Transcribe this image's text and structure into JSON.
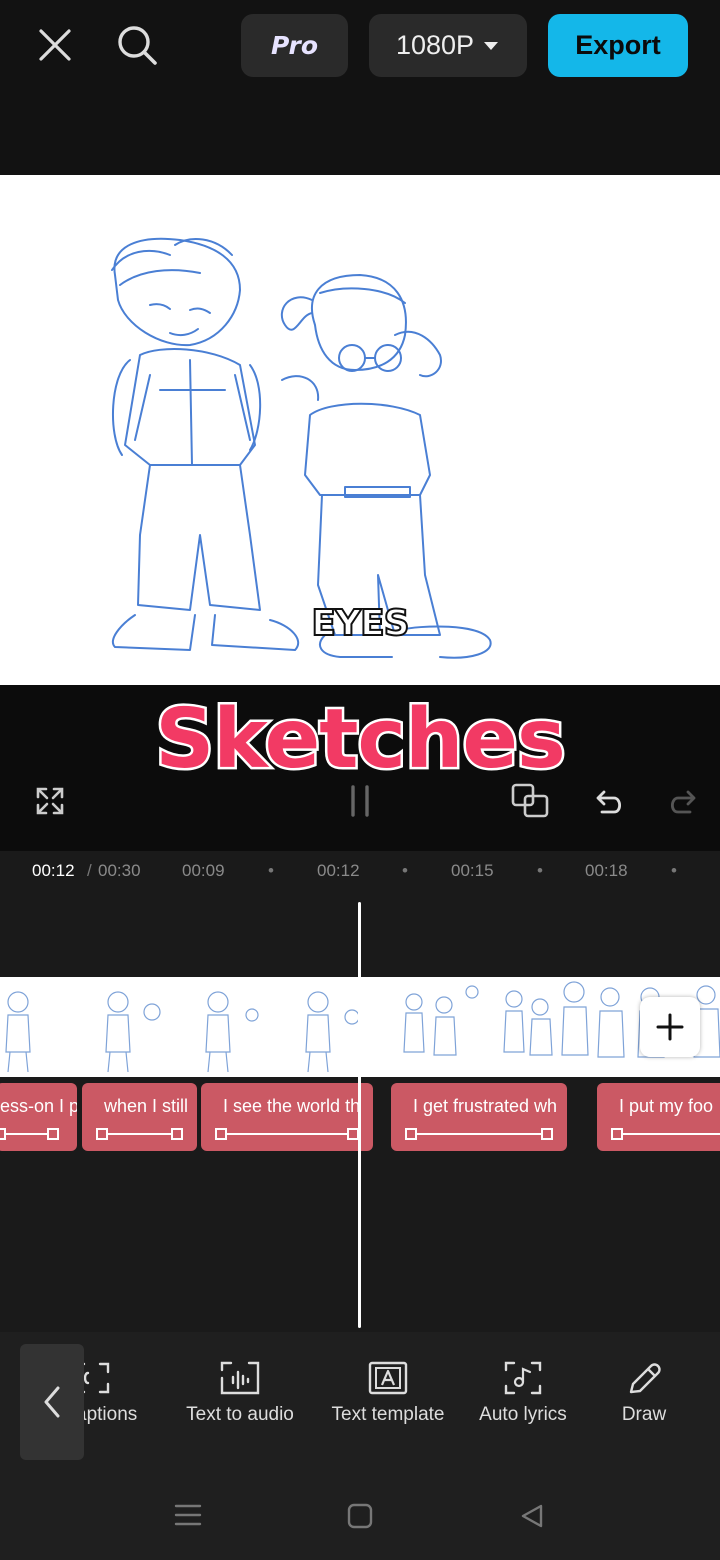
{
  "header": {
    "close_icon": "close-icon",
    "search_icon": "search-icon",
    "pro_label": "Pro",
    "resolution_label": "1080P",
    "export_label": "Export",
    "accent_color": "#14b7e9"
  },
  "preview": {
    "caption_text": "EYES",
    "overlay_title": "Sketches",
    "title_color": "#f23a64"
  },
  "controls": {
    "fullscreen_icon": "fullscreen-icon",
    "play_pause_icon": "pause-icon",
    "keyframe_icon": "keyframe-icon",
    "undo_icon": "undo-icon",
    "redo_icon": "redo-icon"
  },
  "timeline": {
    "current_time": "00:12",
    "separator": "/",
    "total_time": "00:30",
    "ticks": [
      "00:09",
      "00:12",
      "00:15",
      "00:18"
    ],
    "text_clips": [
      "ess-on I p",
      "when I still",
      "I see the world th",
      "I get frustrated wh",
      "I put my foo"
    ],
    "clip_color": "#cb5964"
  },
  "toolbar": {
    "tools": [
      {
        "label": "aptions",
        "icon": "captions-icon"
      },
      {
        "label": "Text to audio",
        "icon": "text-to-audio-icon"
      },
      {
        "label": "Text template",
        "icon": "text-template-icon"
      },
      {
        "label": "Auto lyrics",
        "icon": "auto-lyrics-icon"
      },
      {
        "label": "Draw",
        "icon": "pencil-icon"
      }
    ]
  }
}
